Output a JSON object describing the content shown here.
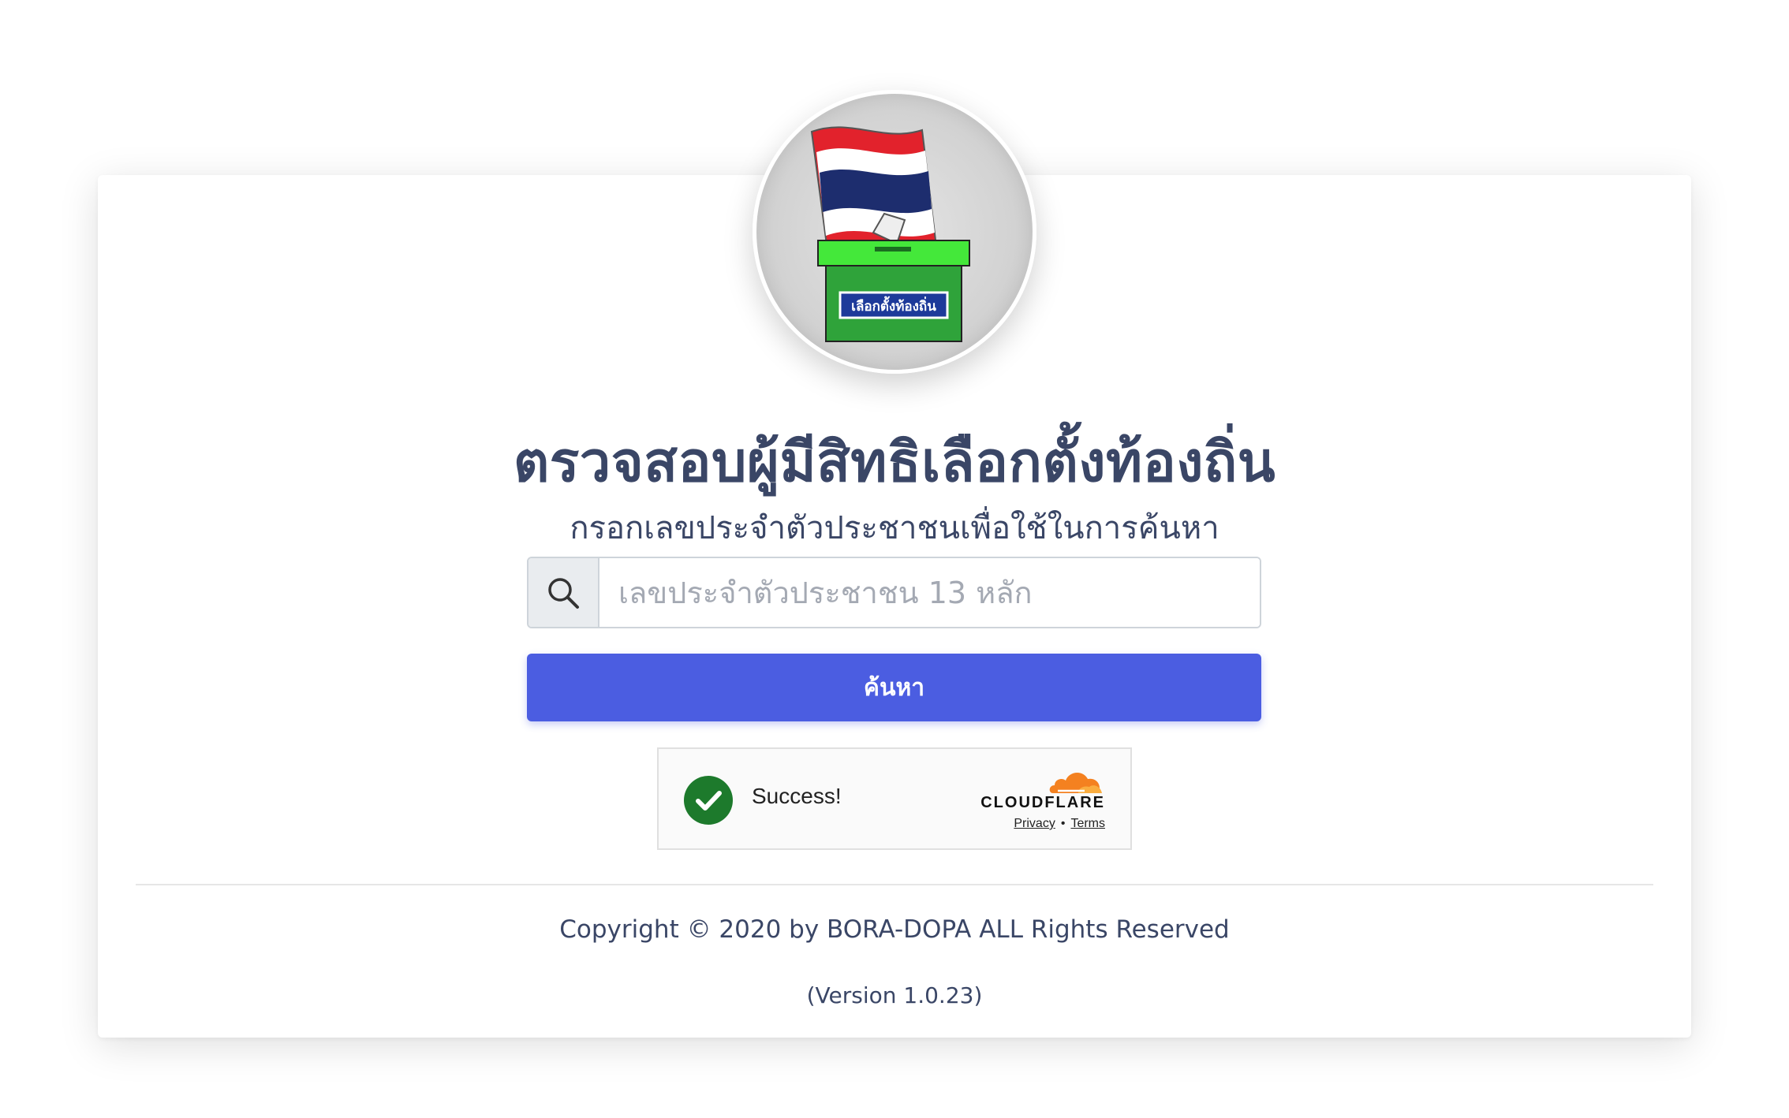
{
  "header": {
    "title": "ตรวจสอบผู้มีสิทธิเลือกตั้งท้องถิ่น",
    "subtitle": "กรอกเลขประจำตัวประชาชนเพื่อใช้ในการค้นหา"
  },
  "logo": {
    "box_label": "เลือกตั้งท้องถิ่น",
    "flag_colors": [
      "#e2222c",
      "#ffffff",
      "#1d2d6e"
    ],
    "box_color": "#2fa33a",
    "icon": "ballot-box-with-thai-flag"
  },
  "search": {
    "placeholder": "เลขประจำตัวประชาชน 13 หลัก",
    "value": "",
    "icon": "search-icon",
    "button_label": "ค้นหา",
    "button_color": "#4b5de1"
  },
  "captcha": {
    "status": "Success!",
    "brand": "CLOUDFLARE",
    "privacy_label": "Privacy",
    "separator": "•",
    "terms_label": "Terms",
    "status_color": "#1d7a2c"
  },
  "footer": {
    "copyright": "Copyright © 2020 by BORA-DOPA ALL Rights Reserved",
    "version": "(Version 1.0.23)"
  }
}
